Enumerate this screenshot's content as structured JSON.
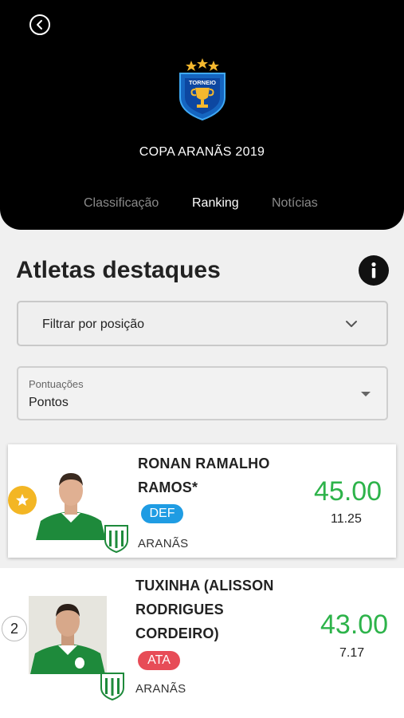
{
  "header": {
    "title": "COPA ARANÃS 2019",
    "logo_text": "TORNEIO",
    "tabs": [
      {
        "label": "Classificação",
        "active": false
      },
      {
        "label": "Ranking",
        "active": true
      },
      {
        "label": "Notícias",
        "active": false
      }
    ]
  },
  "section": {
    "title": "Atletas destaques"
  },
  "filter": {
    "placeholder": "Filtrar por posição"
  },
  "points_select": {
    "label": "Pontuações",
    "value": "Pontos"
  },
  "athletes": [
    {
      "rank_marker": "star",
      "name": "RONAN RAMALHO RAMOS*",
      "position": "DEF",
      "team": "ARANÃS",
      "score": "45.00",
      "sub_score": "11.25"
    },
    {
      "rank": "2",
      "name": "TUXINHA (ALISSON RODRIGUES CORDEIRO)",
      "position": "ATA",
      "team": "ARANÃS",
      "score": "43.00",
      "sub_score": "7.17"
    }
  ],
  "colors": {
    "header_bg": "#000000",
    "score_green": "#2db34a",
    "def_badge": "#1f9ce3",
    "ata_badge": "#e74c57",
    "star_badge": "#f3b624"
  }
}
